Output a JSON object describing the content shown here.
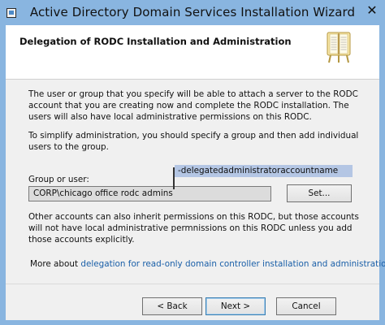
{
  "window": {
    "title": "Active Directory Domain Services Installation Wizard",
    "close_glyph": "✕"
  },
  "header": {
    "title": "Delegation of RODC Installation and Administration",
    "icon": "book-icon"
  },
  "content": {
    "paragraph1": "The user or group that you specify will be able to attach a server to the RODC account that you are creating now and complete the RODC installation. The users will also have local administrative permissions on this RODC.",
    "paragraph2": "To simplify administration, you should specify a group and then add individual users to the group.",
    "group_label": "Group or user:",
    "group_value": "CORP\\chicago office rodc admins",
    "callout": "-delegatedadministratoraccountname",
    "set_button": "Set...",
    "paragraph3": "Other accounts can also inherit permissions on this RODC, but those accounts will not have local administrative permnissions on this RODC unless you add those accounts explicitly.",
    "more_prefix": "More about ",
    "more_link": "delegation for read-only domain controller installation and administration"
  },
  "footer": {
    "back": "< Back",
    "next": "Next >",
    "cancel": "Cancel"
  },
  "colors": {
    "titlebar": "#89b5e0",
    "link": "#1a5fa8",
    "callout": "#b4c6e4"
  }
}
